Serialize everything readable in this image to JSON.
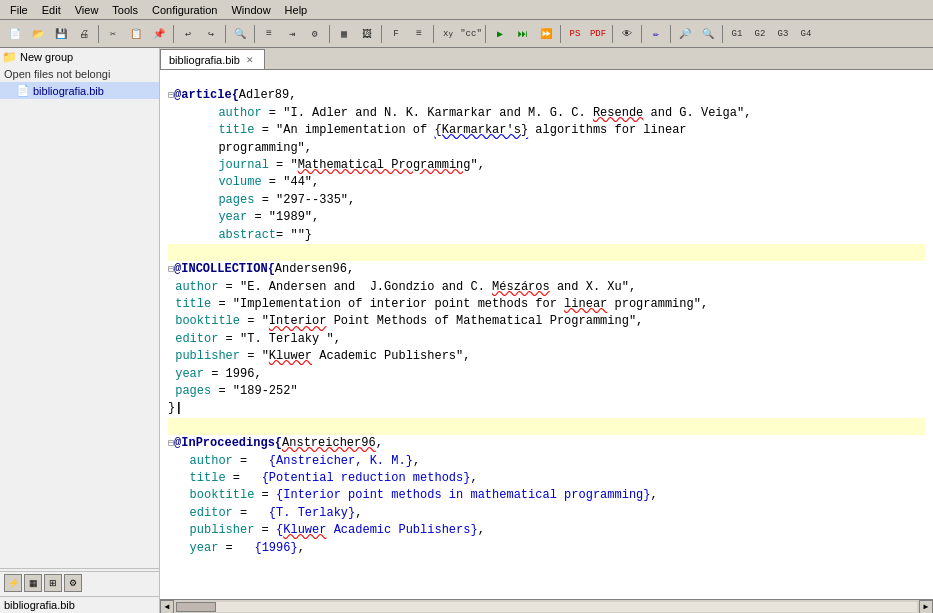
{
  "menubar": {
    "items": [
      "File",
      "Edit",
      "View",
      "Tools",
      "Configuration",
      "Window",
      "Help"
    ]
  },
  "toolbar": {
    "buttons": [
      "new",
      "open",
      "save",
      "print",
      "sep",
      "cut",
      "copy",
      "paste",
      "sep",
      "undo",
      "redo",
      "sep",
      "find",
      "sep",
      "run1",
      "run2",
      "run3",
      "sep",
      "ps",
      "pdf",
      "sep",
      "pen",
      "sep",
      "zoom",
      "sep",
      "g1",
      "g2",
      "g3",
      "g4",
      "sep",
      "app"
    ]
  },
  "tabs": [
    {
      "label": "bibliografia.bib",
      "active": true
    }
  ],
  "sidebar": {
    "new_group_label": "New group",
    "open_files_label": "Open files not belongi",
    "file_label": "bibliografia.bib",
    "bottom_label": "bibliografia.bib"
  },
  "editor": {
    "blocks": [
      {
        "id": "Adler89",
        "type": "@article",
        "fields": [
          {
            "key": "author",
            "value": "\"I. Adler and N. K. Karmarkar and M. G. C. Resende and G. Veiga\""
          },
          {
            "key": "title",
            "value": "\"An implementation of {Karmarkar's} algorithms for linear\n           programming\""
          },
          {
            "key": "journal",
            "value": "\"Mathematical Programming\""
          },
          {
            "key": "volume",
            "value": "\"44\""
          },
          {
            "key": "pages",
            "value": "\"297--335\""
          },
          {
            "key": "year",
            "value": "\"1989\""
          },
          {
            "key": "abstract",
            "value": "\"\""
          }
        ]
      },
      {
        "id": "Andersen96",
        "type": "@INCOLLECTION",
        "fields": [
          {
            "key": "author",
            "value": "\"E. Andersen and  J.Gondzio and C. Mészáros and X. Xu\""
          },
          {
            "key": "title",
            "value": "\"Implementation of interior point methods for linear programming\""
          },
          {
            "key": "booktitle",
            "value": "\"Interior Point Methods of Mathematical Programming\""
          },
          {
            "key": "editor",
            "value": "\"T. Terlaky \""
          },
          {
            "key": "publisher",
            "value": "\"Kluwer Academic Publishers\""
          },
          {
            "key": "year",
            "value": "1996"
          },
          {
            "key": "pages",
            "value": "\"189-252\""
          }
        ]
      },
      {
        "id": "Anstreicher96",
        "type": "@InProceedings",
        "fields": [
          {
            "key": "author",
            "value": "{Anstreicher, K. M.}"
          },
          {
            "key": "title",
            "value": "{Potential reduction methods}"
          },
          {
            "key": "booktitle",
            "value": "{Interior point methods in mathematical programming}"
          },
          {
            "key": "editor",
            "value": "{T. Terlaky}"
          },
          {
            "key": "publisher",
            "value": "{Kluwer Academic Publishers}"
          },
          {
            "key": "year",
            "value": "{1996}"
          }
        ]
      }
    ]
  }
}
